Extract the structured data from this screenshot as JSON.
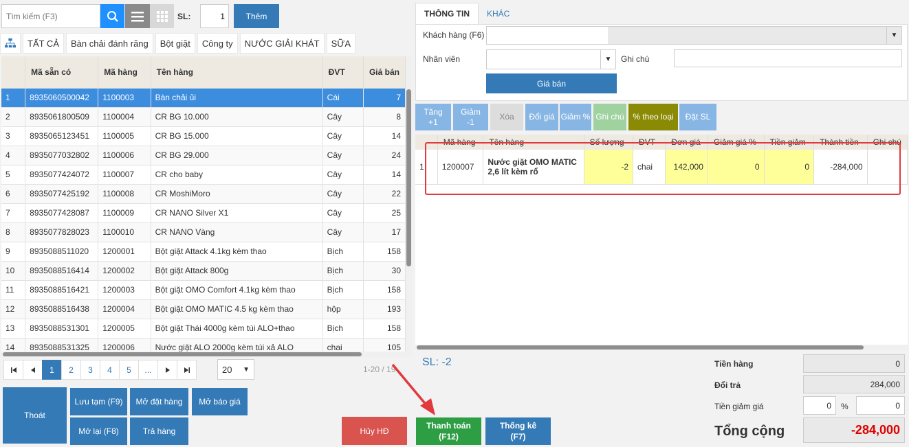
{
  "toolbar": {
    "search_placeholder": "Tìm kiếm (F3)",
    "sl_label": "SL:",
    "sl_value": "1",
    "add_label": "Thêm"
  },
  "categories": [
    "TẤT CẢ",
    "Bàn chải đánh răng",
    "Bột giặt",
    "Công ty",
    "NƯỚC GIẢI KHÁT",
    "SỮA"
  ],
  "product_table": {
    "columns": [
      "",
      "Mã sẵn có",
      "Mã hàng",
      "Tên hàng",
      "ĐVT",
      "Giá bán"
    ],
    "rows": [
      [
        "1",
        "8935060500042",
        "1100003",
        "Bàn chải ủi",
        "Cái",
        "7"
      ],
      [
        "2",
        "8935061800509",
        "1100004",
        "CR BG 10.000",
        "Cây",
        "8"
      ],
      [
        "3",
        "8935065123451",
        "1100005",
        "CR BG 15.000",
        "Cây",
        "14"
      ],
      [
        "4",
        "8935077032802",
        "1100006",
        "CR BG 29.000",
        "Cây",
        "24"
      ],
      [
        "5",
        "8935077424072",
        "1100007",
        "CR cho baby",
        "Cây",
        "14"
      ],
      [
        "6",
        "8935077425192",
        "1100008",
        "CR MoshiMoro",
        "Cây",
        "22"
      ],
      [
        "7",
        "8935077428087",
        "1100009",
        "CR NANO Silver X1",
        "Cây",
        "25"
      ],
      [
        "8",
        "8935077828023",
        "1100010",
        "CR NANO Vàng",
        "Cây",
        "17"
      ],
      [
        "9",
        "8935088511020",
        "1200001",
        "Bột giặt Attack 4.1kg kèm thao",
        "Bịch",
        "158"
      ],
      [
        "10",
        "8935088516414",
        "1200002",
        "Bột giặt Attack 800g",
        "Bịch",
        "30"
      ],
      [
        "11",
        "8935088516421",
        "1200003",
        "Bột giặt OMO Comfort 4.1kg kèm thao",
        "Bịch",
        "158"
      ],
      [
        "12",
        "8935088516438",
        "1200004",
        "Bột giặt OMO MATIC 4.5 kg kèm thao",
        "hộp",
        "193"
      ],
      [
        "13",
        "8935088531301",
        "1200005",
        "Bột giặt Thái 4000g kèm túi ALO+thao",
        "Bịch",
        "158"
      ],
      [
        "14",
        "8935088531325",
        "1200006",
        "Nước giặt ALO 2000g kèm túi xả ALO",
        "chai",
        "105"
      ]
    ]
  },
  "pager": {
    "first": "⏮",
    "prev": "◀",
    "pages": [
      "1",
      "2",
      "3",
      "4",
      "5",
      "..."
    ],
    "next": "▶",
    "last": "⏭",
    "page_size": "20",
    "info": "1-20 / 19"
  },
  "left_buttons": {
    "exit": "Thoát",
    "save_temp": "Lưu tạm (F9)",
    "open_order": "Mở đặt hàng",
    "open_quote": "Mở báo giá",
    "reopen": "Mở lại (F8)",
    "return": "Trả hàng",
    "cancel": "Hủy HĐ"
  },
  "right_tabs": {
    "info": "THÔNG TIN",
    "other": "KHÁC"
  },
  "info_form": {
    "customer_label": "Khách hàng (F6)",
    "staff_label": "Nhân viên",
    "note_label": "Ghi chú",
    "price_button": "Giá bán"
  },
  "actions": {
    "inc": "Tăng\n+1",
    "dec": "Giảm\n-1",
    "del": "Xóa",
    "change_price": "Đổi giá",
    "discount_pct": "Giảm %",
    "note": "Ghi chú",
    "pct_by_type": "% theo loại",
    "set_qty": "Đặt SL"
  },
  "cart_table": {
    "columns": [
      "",
      "Mã hàng",
      "Tên hàng",
      "Số lượng",
      "ĐVT",
      "Đơn giá",
      "Giảm giá %",
      "Tiền giảm",
      "Thành tiền",
      "Ghi chú"
    ],
    "rows": [
      [
        "1",
        "1200007",
        "Nước giặt OMO MATIC 2,6 lít kèm rổ",
        "-2",
        "chai",
        "142,000",
        "0",
        "0",
        "-284,000",
        ""
      ]
    ]
  },
  "totals": {
    "sl_text": "SL: -2",
    "goods_label": "Tiền hàng",
    "goods_value": "0",
    "return_label": "Đổi trả",
    "return_value": "284,000",
    "discount_label": "Tiền giảm giá",
    "discount_value": "0",
    "pct_sign": "%",
    "pct_value": "0",
    "total_label": "Tổng cộng",
    "total_value": "-284,000"
  },
  "bottom_buttons": {
    "pay": "Thanh toán\n(F12)",
    "stats": "Thống kê\n(F7)"
  },
  "colors": {
    "primary": "#337ab7",
    "selected_row": "#3c8dde",
    "pay": "#2e9e45",
    "cancel": "#d9534f",
    "highlight": "#ffff99",
    "total_red": "#e00000",
    "annotation_red": "#e0393e"
  }
}
